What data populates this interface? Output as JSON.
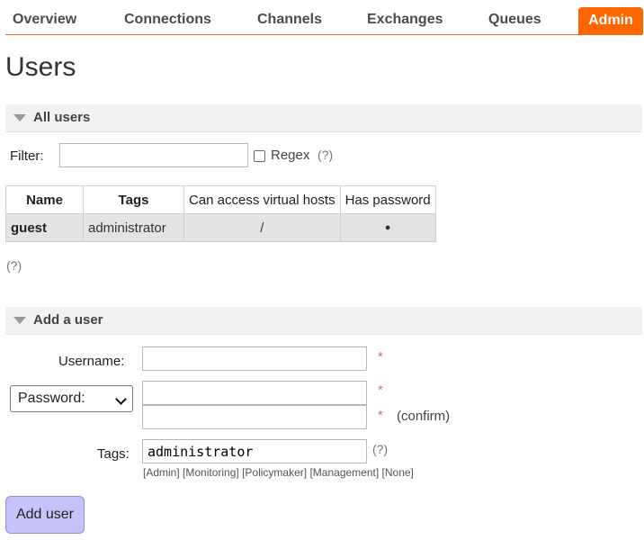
{
  "nav": {
    "tabs": [
      {
        "label": "Overview"
      },
      {
        "label": "Connections"
      },
      {
        "label": "Channels"
      },
      {
        "label": "Exchanges"
      },
      {
        "label": "Queues"
      },
      {
        "label": "Admin",
        "active": true
      }
    ]
  },
  "page_title": "Users",
  "all_users": {
    "header": "All users",
    "filter_label": "Filter:",
    "filter_value": "",
    "regex_label": "Regex",
    "regex_checked": false,
    "help": "(?)",
    "table": {
      "columns": [
        "Name",
        "Tags",
        "Can access virtual hosts",
        "Has password"
      ],
      "rows": [
        {
          "name": "guest",
          "tags": "administrator",
          "vhosts": "/",
          "has_password": "●"
        }
      ]
    },
    "table_help": "(?)"
  },
  "add_user": {
    "header": "Add a user",
    "username_label": "Username:",
    "username_value": "",
    "password_select": "Password:",
    "password_value": "",
    "confirm_value": "",
    "required_mark": "*",
    "confirm_label": "(confirm)",
    "tags_label": "Tags:",
    "tags_value": "administrator",
    "tags_help": "(?)",
    "tag_options": [
      "Admin",
      "Monitoring",
      "Policymaker",
      "Management",
      "None"
    ],
    "submit_label": "Add user"
  },
  "colors": {
    "accent": "#ff6600",
    "section_bg": "#f2f2f2",
    "row_bg": "#e4e4e4",
    "button_bg": "#c6c4fb",
    "required": "#e26a6a"
  }
}
